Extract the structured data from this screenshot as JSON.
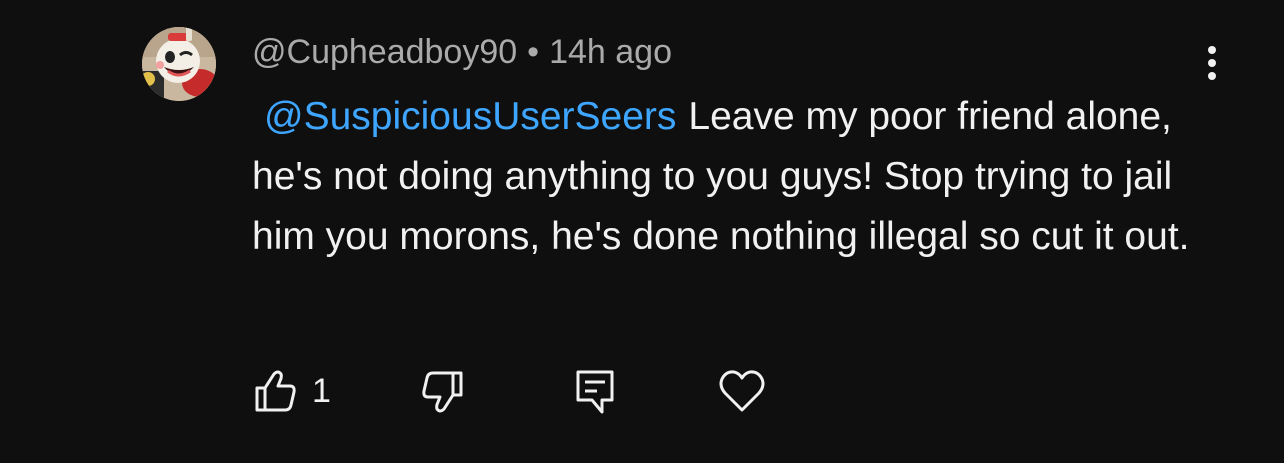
{
  "comment": {
    "author": "@Cupheadboy90",
    "separator": "•",
    "timestamp": "14h ago",
    "mention": "@SuspiciousUserSeers",
    "text": "Leave my poor friend alone, he's not doing anything to you guys! Stop trying to jail him you morons, he's done nothing illegal so cut it out.",
    "avatar_icon": "cuphead-avatar"
  },
  "actions": {
    "like_icon": "thumbs-up-icon",
    "like_count": "1",
    "dislike_icon": "thumbs-down-icon",
    "reply_icon": "reply-comment-icon",
    "heart_icon": "heart-icon",
    "menu_icon": "more-vert-icon"
  },
  "colors": {
    "background": "#0f0f0f",
    "text": "#f1f1f1",
    "secondary_text": "#aaaaaa",
    "mention": "#3ea6ff"
  }
}
